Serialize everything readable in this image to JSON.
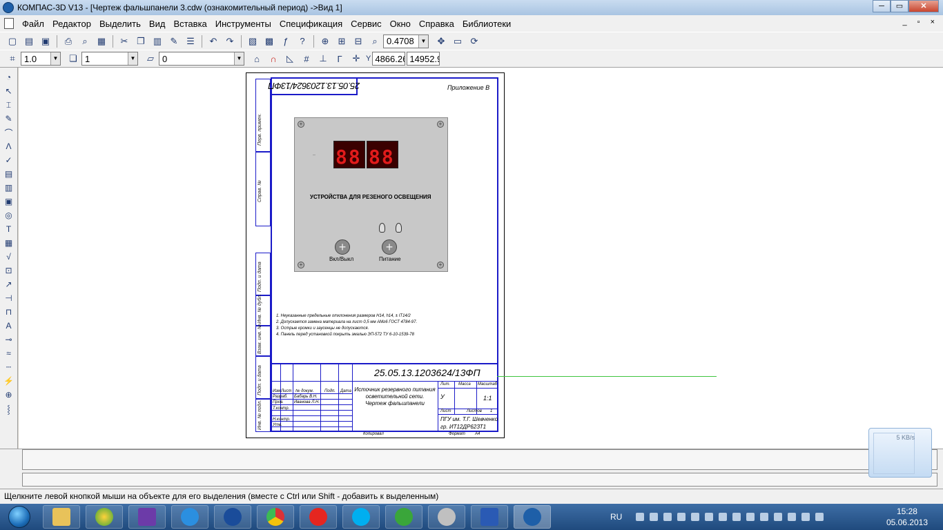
{
  "window": {
    "title": "КОМПАС-3D V13 - [Чертеж фальшпанели 3.cdw (ознакомительный период) ->Вид 1]",
    "buttons": {
      "minimize": "─",
      "maximize": "▭",
      "close": "✕"
    }
  },
  "menu": {
    "items": [
      "Файл",
      "Редактор",
      "Выделить",
      "Вид",
      "Вставка",
      "Инструменты",
      "Спецификация",
      "Сервис",
      "Окно",
      "Справка",
      "Библиотеки"
    ],
    "mdi_controls": "_ ▫ ×"
  },
  "toolbar1": {
    "zoom_value": "0.4708"
  },
  "toolbar2": {
    "step_value": "1.0",
    "layer_value": "1",
    "style_value": "0",
    "coord_x": "4866.26",
    "coord_y": "14952.9"
  },
  "drawing": {
    "doc_number_rotated": "25.05.13.1203624/13ФП",
    "appendix": "Приложение В",
    "panel_label": "УСТРОЙСТВА ДЛЯ РЕЗЕНОГО ОСВЕЩЕНИЯ",
    "digits_left": "88",
    "digits_right": "88",
    "knob_left_label": "Вкл/Выкл",
    "knob_right_label": "Питание",
    "side_labels": [
      "Перв. примен.",
      "Справ. №",
      "Подп. и дата",
      "Инв. № дубл.",
      "Взам. инв. №",
      "Подп. и дата",
      "Инв. № подл."
    ],
    "notes": [
      "1. Неуказанные предельные отклонения размеров Н14, h14, ± IT14/2",
      "2. Допускается замена материала на лист 0,5 мм АМг6 ГОСТ 4784-97.",
      "3. Острые кромки и заусенцы не допускаются.",
      "4. Панель перед установкой покрыть эмалью ЭП-572 ТУ 6-10-1539-78"
    ],
    "stamp": {
      "doc_number": "25.05.13.1203624/13ФП",
      "title_line1": "Источник резервного питания",
      "title_line2": "осветительной сети.",
      "title_line3": "Чертеж фальшпанели",
      "col_headers": [
        "Изм",
        "Лист",
        "№ докум.",
        "Подп.",
        "Дата"
      ],
      "rows": [
        "Разраб.",
        "Пров.",
        "Т.контр.",
        "Н.контр.",
        "Утв."
      ],
      "developer": "Бабарь В.Н.",
      "checker": "Иванова Л.Н.",
      "lit_header": "Лит.",
      "mass_header": "Масса",
      "scale_header": "Масштаб",
      "lit_value": "У",
      "scale_value": "1:1",
      "sheet_label": "Лист",
      "sheets_label": "Листов",
      "sheets_value": "1",
      "org_line1": "ПГУ им. Т.Г. Шевченко",
      "org_line2": "гр. ИТ12ДР62ЗТ1",
      "copied": "Копировал",
      "format": "Формат",
      "format_value": "А4"
    }
  },
  "status": {
    "hint": "Щелкните левой кнопкой мыши на объекте для его выделения (вместе с Ctrl или Shift - добавить к выделенным)"
  },
  "netwidget": {
    "speed": "5 KB/s"
  },
  "taskbar": {
    "lang": "RU",
    "time": "15:28",
    "date": "05.06.2013"
  }
}
